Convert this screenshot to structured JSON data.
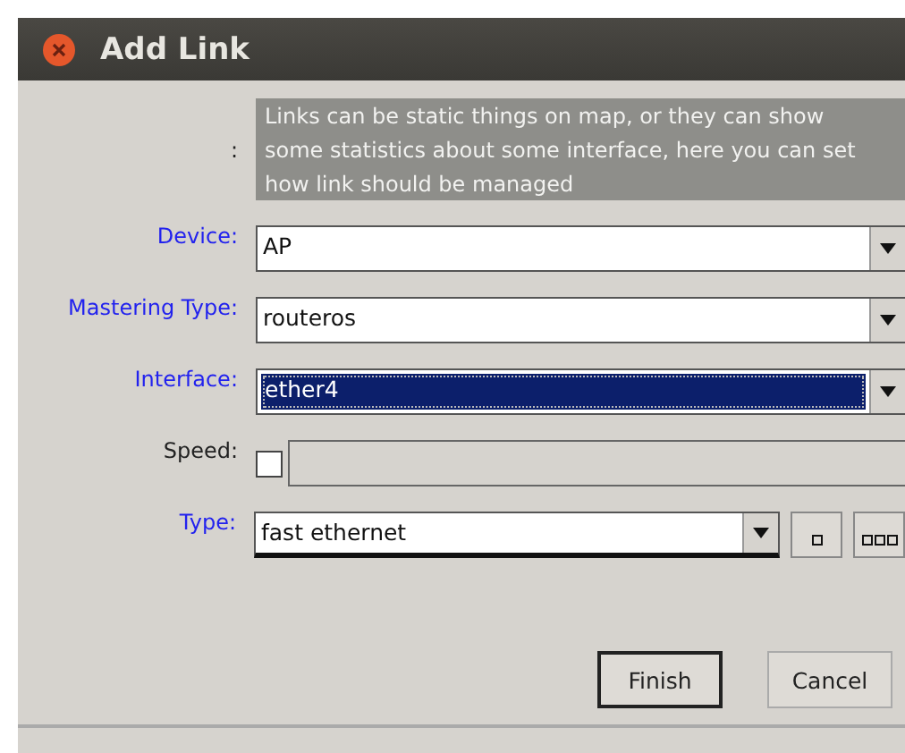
{
  "window": {
    "title": "Add Link"
  },
  "info": {
    "label": ":",
    "text": "Links can be static things on map, or they can show some statistics about some interface, here you can set how link should be managed"
  },
  "fields": [
    {
      "label": "Device:",
      "kind": "combo",
      "emphasized": true,
      "value": "AP",
      "selected": false
    },
    {
      "label": "Mastering Type:",
      "kind": "combo",
      "emphasized": true,
      "value": "routeros",
      "selected": false
    },
    {
      "label": "Interface:",
      "kind": "combo",
      "emphasized": true,
      "value": "ether4",
      "selected": true
    },
    {
      "label": "Speed:",
      "kind": "check",
      "emphasized": false,
      "checked": false
    },
    {
      "label": "Type:",
      "kind": "combo-extra",
      "emphasized": true,
      "value": "fast ethernet",
      "selected": false
    }
  ],
  "buttons": [
    {
      "label": "Finish",
      "default": true
    },
    {
      "label": "Cancel",
      "default": false
    }
  ]
}
